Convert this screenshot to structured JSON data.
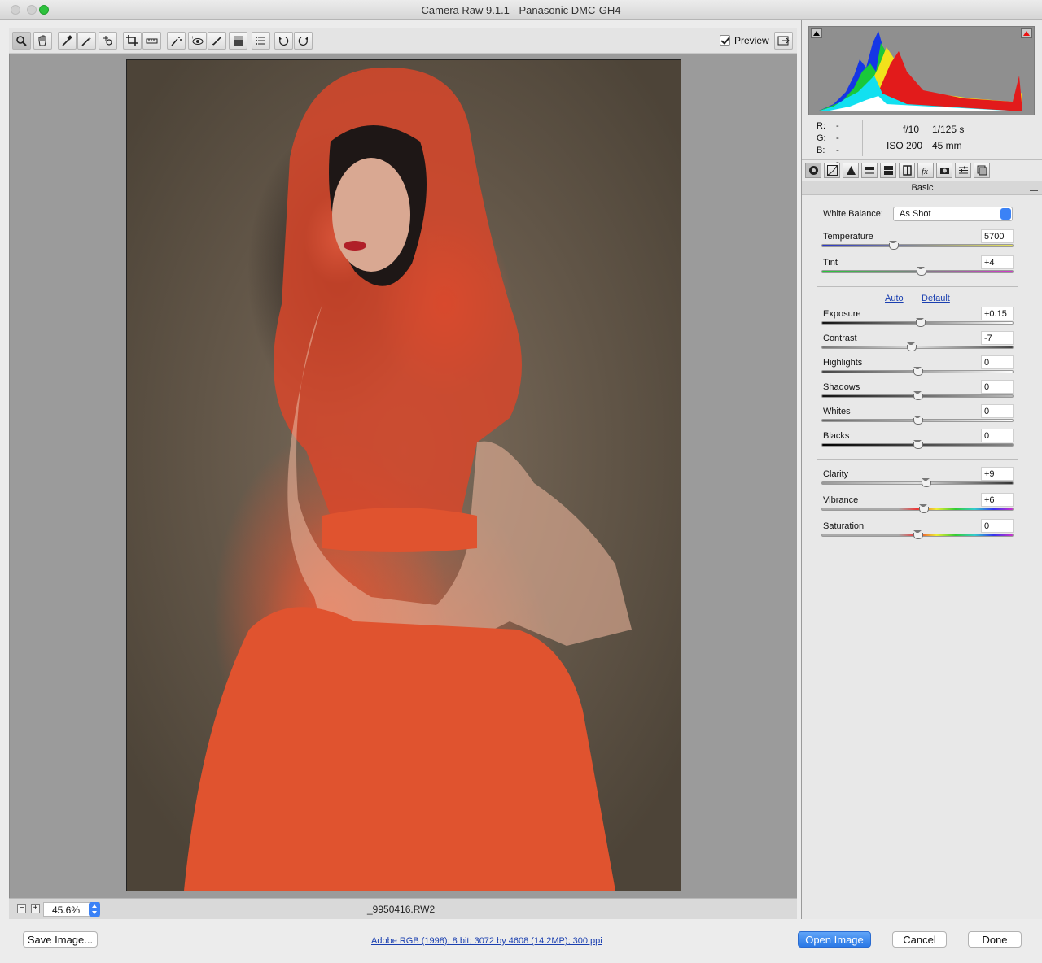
{
  "window": {
    "title": "Camera Raw 9.1.1  -  Panasonic DMC-GH4"
  },
  "toolbar": {
    "tools": [
      "zoom-icon",
      "hand-icon",
      "white-balance-icon",
      "color-sampler-icon",
      "targeted-adjustment-icon",
      "crop-icon",
      "straighten-icon",
      "spot-removal-icon",
      "red-eye-icon",
      "adjustment-brush-icon",
      "graduated-filter-icon",
      "radial-filter-icon",
      "preferences-icon",
      "rotate-left-icon",
      "rotate-right-icon"
    ],
    "preview_label": "Preview",
    "preview_checked": true
  },
  "status": {
    "zoom": "45.6%",
    "filename": "_9950416.RW2"
  },
  "info": {
    "r_label": "R:",
    "g_label": "G:",
    "b_label": "B:",
    "r_val": "---",
    "g_val": "---",
    "b_val": "---",
    "aperture": "f/10",
    "shutter": "1/125 s",
    "iso": "ISO 200",
    "focal": "45 mm"
  },
  "panel": {
    "title": "Basic",
    "white_balance_label": "White Balance:",
    "white_balance_value": "As Shot",
    "auto_label": "Auto",
    "default_label": "Default",
    "sliders": [
      {
        "key": "temperature",
        "label": "Temperature",
        "value": "5700"
      },
      {
        "key": "tint",
        "label": "Tint",
        "value": "+4"
      },
      {
        "key": "exposure",
        "label": "Exposure",
        "value": "+0.15"
      },
      {
        "key": "contrast",
        "label": "Contrast",
        "value": "-7"
      },
      {
        "key": "highlights",
        "label": "Highlights",
        "value": "0"
      },
      {
        "key": "shadows",
        "label": "Shadows",
        "value": "0"
      },
      {
        "key": "whites",
        "label": "Whites",
        "value": "0"
      },
      {
        "key": "blacks",
        "label": "Blacks",
        "value": "0"
      },
      {
        "key": "clarity",
        "label": "Clarity",
        "value": "+9"
      },
      {
        "key": "vibrance",
        "label": "Vibrance",
        "value": "+6"
      },
      {
        "key": "saturation",
        "label": "Saturation",
        "value": "0"
      }
    ]
  },
  "bottom": {
    "save_label": "Save Image...",
    "workflow": "Adobe RGB (1998); 8 bit; 3072 by 4608 (14.2MP); 300 ppi",
    "open_label": "Open Image",
    "cancel_label": "Cancel",
    "done_label": "Done"
  }
}
